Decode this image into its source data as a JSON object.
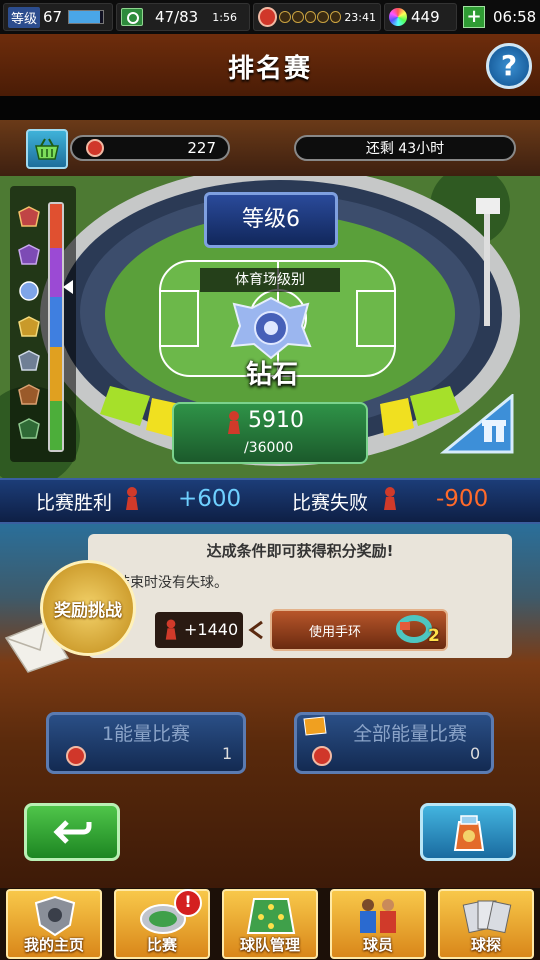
{
  "status_bar": {
    "level_tag": "等级",
    "level_value": "67",
    "xp_fill": 0.9,
    "stamina": "47/83",
    "stamina_timer": "1:56",
    "token_timer": "23:41",
    "gems": "449",
    "plus": "+",
    "clock": "06:58"
  },
  "header": {
    "title": "排名赛",
    "help": "?"
  },
  "info": {
    "points": "227",
    "time_left": "还剩 43小时"
  },
  "stadium": {
    "level": "等级6",
    "stadium_level_label": "体育场级别",
    "tier_name": "钻石",
    "score": "5910",
    "score_max": "/36000",
    "tier_progress": 0.16
  },
  "results": {
    "win_label": "比赛胜利",
    "win_value": "+600",
    "loss_label": "比赛失败",
    "loss_value": "-900"
  },
  "challenge": {
    "title": "达成条件即可获得积分奖励!",
    "condition": "结束时没有失球。",
    "reward": "+1440",
    "use_button": "使用手环",
    "band_count": "2",
    "medal_text": "奖励挑战"
  },
  "energy": {
    "one": {
      "label": "1能量比赛",
      "count": "1"
    },
    "all": {
      "label": "全部能量比赛",
      "count": "0"
    }
  },
  "nav": {
    "home": "我的主页",
    "match": "比赛",
    "team": "球队管理",
    "players": "球员",
    "scout": "球探",
    "match_alert": "!"
  },
  "colors": {
    "win": "#6fd0ff",
    "loss": "#ff6a2a"
  }
}
